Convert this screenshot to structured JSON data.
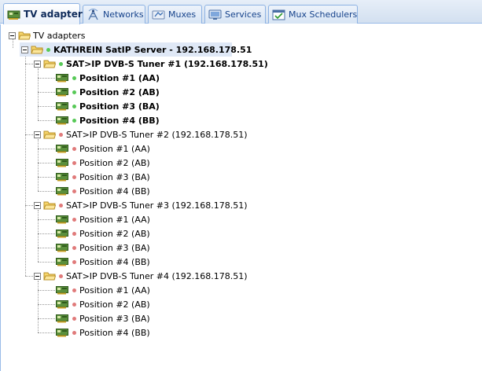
{
  "tabs": [
    {
      "label": "TV adapters",
      "icon": "adapter-card-icon",
      "active": true
    },
    {
      "label": "Networks",
      "icon": "antenna-icon",
      "active": false
    },
    {
      "label": "Muxes",
      "icon": "mux-icon",
      "active": false
    },
    {
      "label": "Services",
      "icon": "tv-icon",
      "active": false
    },
    {
      "label": "Mux Schedulers",
      "icon": "calendar-icon",
      "active": false
    }
  ],
  "tree": {
    "root": {
      "label": "TV adapters"
    },
    "server": {
      "label": "KATHREIN SatIP Server - 192.168.178.51",
      "status": "green"
    },
    "tuners": [
      {
        "label": "SAT>IP DVB-S Tuner #1 (192.168.178.51)",
        "status": "green",
        "positions": [
          {
            "label": "Position #1 (AA)",
            "status": "green"
          },
          {
            "label": "Position #2 (AB)",
            "status": "green"
          },
          {
            "label": "Position #3 (BA)",
            "status": "green"
          },
          {
            "label": "Position #4 (BB)",
            "status": "green"
          }
        ]
      },
      {
        "label": "SAT>IP DVB-S Tuner #2 (192.168.178.51)",
        "status": "red",
        "positions": [
          {
            "label": "Position #1 (AA)",
            "status": "red"
          },
          {
            "label": "Position #2 (AB)",
            "status": "red"
          },
          {
            "label": "Position #3 (BA)",
            "status": "red"
          },
          {
            "label": "Position #4 (BB)",
            "status": "red"
          }
        ]
      },
      {
        "label": "SAT>IP DVB-S Tuner #3 (192.168.178.51)",
        "status": "red",
        "positions": [
          {
            "label": "Position #1 (AA)",
            "status": "red"
          },
          {
            "label": "Position #2 (AB)",
            "status": "red"
          },
          {
            "label": "Position #3 (BA)",
            "status": "red"
          },
          {
            "label": "Position #4 (BB)",
            "status": "red"
          }
        ]
      },
      {
        "label": "SAT>IP DVB-S Tuner #4 (192.168.178.51)",
        "status": "red",
        "positions": [
          {
            "label": "Position #1 (AA)",
            "status": "red"
          },
          {
            "label": "Position #2 (AB)",
            "status": "red"
          },
          {
            "label": "Position #3 (BA)",
            "status": "red"
          },
          {
            "label": "Position #4 (BB)",
            "status": "red"
          }
        ]
      }
    ]
  },
  "colors": {
    "status_green": "#57c957",
    "status_red": "#e07a7a",
    "selection": "#dfe8f6",
    "tab_text": "#15428b"
  }
}
